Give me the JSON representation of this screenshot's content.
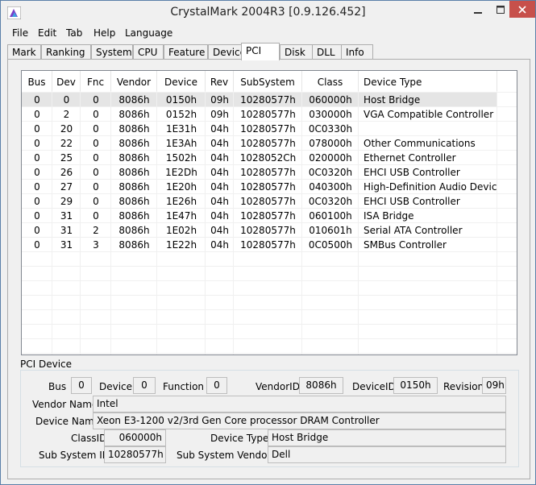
{
  "window": {
    "title": "CrystalMark 2004R3 [0.9.126.452]"
  },
  "menu": [
    "File",
    "Edit",
    "Tab",
    "Help",
    "Language"
  ],
  "tabs": [
    "Mark",
    "Ranking",
    "System",
    "CPU",
    "Feature",
    "Device",
    "PCI",
    "Disk",
    "DLL",
    "Info"
  ],
  "active_tab": "PCI",
  "table": {
    "columns": [
      "Bus",
      "Dev",
      "Fnc",
      "Vendor",
      "Device",
      "Rev",
      "SubSystem",
      "Class",
      "Device Type"
    ],
    "rows": [
      [
        "0",
        "0",
        "0",
        "8086h",
        "0150h",
        "09h",
        "10280577h",
        "060000h",
        "Host Bridge"
      ],
      [
        "0",
        "2",
        "0",
        "8086h",
        "0152h",
        "09h",
        "10280577h",
        "030000h",
        "VGA Compatible Controller"
      ],
      [
        "0",
        "20",
        "0",
        "8086h",
        "1E31h",
        "04h",
        "10280577h",
        "0C0330h",
        ""
      ],
      [
        "0",
        "22",
        "0",
        "8086h",
        "1E3Ah",
        "04h",
        "10280577h",
        "078000h",
        "Other Communications"
      ],
      [
        "0",
        "25",
        "0",
        "8086h",
        "1502h",
        "04h",
        "1028052Ch",
        "020000h",
        "Ethernet Controller"
      ],
      [
        "0",
        "26",
        "0",
        "8086h",
        "1E2Dh",
        "04h",
        "10280577h",
        "0C0320h",
        "EHCI USB Controller"
      ],
      [
        "0",
        "27",
        "0",
        "8086h",
        "1E20h",
        "04h",
        "10280577h",
        "040300h",
        "High-Definition Audio Device"
      ],
      [
        "0",
        "29",
        "0",
        "8086h",
        "1E26h",
        "04h",
        "10280577h",
        "0C0320h",
        "EHCI USB Controller"
      ],
      [
        "0",
        "31",
        "0",
        "8086h",
        "1E47h",
        "04h",
        "10280577h",
        "060100h",
        "ISA Bridge"
      ],
      [
        "0",
        "31",
        "2",
        "8086h",
        "1E02h",
        "04h",
        "10280577h",
        "010601h",
        "Serial ATA Controller"
      ],
      [
        "0",
        "31",
        "3",
        "8086h",
        "1E22h",
        "04h",
        "10280577h",
        "0C0500h",
        "SMBus Controller"
      ]
    ]
  },
  "pci_device": {
    "section_label": "PCI Device",
    "labels": {
      "bus": "Bus",
      "device": "Device",
      "function": "Function",
      "vendor_id": "VendorID",
      "device_id": "DeviceID",
      "revision": "Revision",
      "vendor_name": "Vendor Name",
      "device_name": "Device Name",
      "class_id": "ClassID",
      "device_type": "Device Type",
      "sub_system_id": "Sub System ID",
      "sub_system_vendor": "Sub System Vendor"
    },
    "values": {
      "bus": "0",
      "device": "0",
      "function": "0",
      "vendor_id": "8086h",
      "device_id": "0150h",
      "revision": "09h",
      "vendor_name": "Intel",
      "device_name": "Xeon E3-1200 v2/3rd Gen Core processor DRAM Controller",
      "class_id": "060000h",
      "device_type": "Host Bridge",
      "sub_system_id": "10280577h",
      "sub_system_vendor": "Dell"
    }
  },
  "colors": {
    "close_button": "#c7504b",
    "selected_row": "#e5e5e5",
    "window_bg": "#f0f0f0"
  }
}
